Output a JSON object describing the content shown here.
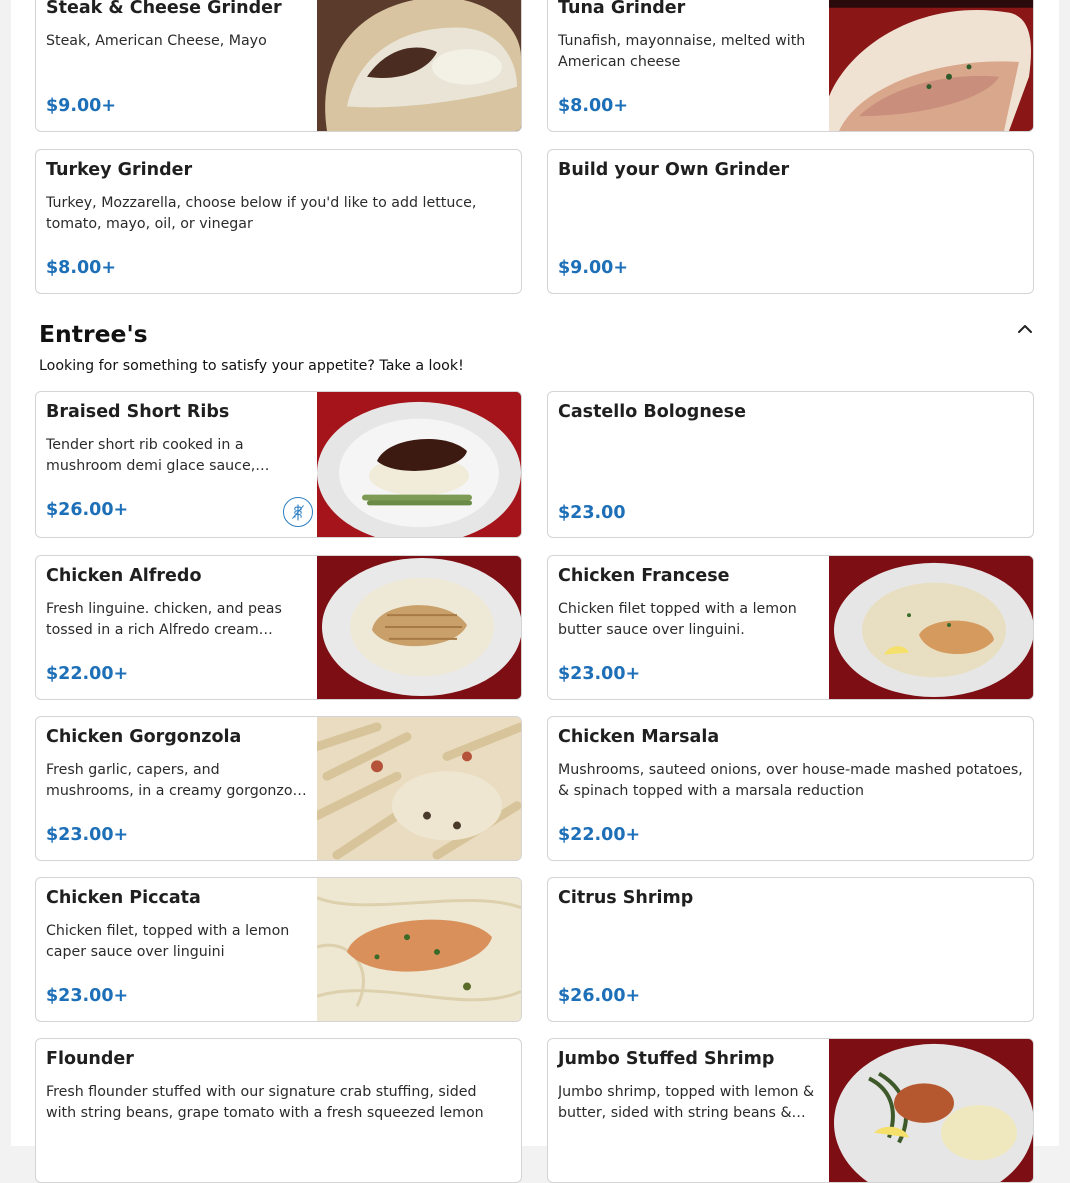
{
  "grinders": [
    {
      "name": "Steak & Cheese Grinder",
      "description": "Steak, American Cheese, Mayo",
      "price": "$9.00+"
    },
    {
      "name": "Tuna Grinder",
      "description": "Tunafish, mayonnaise, melted with American cheese",
      "price": "$8.00+"
    },
    {
      "name": "Turkey Grinder",
      "description": "Turkey, Mozzarella, choose below if you'd like to add lettuce, tomato, mayo, oil, or vinegar",
      "price": "$8.00+"
    },
    {
      "name": "Build your Own Grinder",
      "description": "",
      "price": "$9.00+"
    }
  ],
  "entrees_section": {
    "title": "Entree's",
    "subtitle": "Looking for something to satisfy your appetite? Take a look!",
    "collapse_icon": "chevron-up-icon"
  },
  "entrees": [
    {
      "name": "Braised Short Ribs",
      "description": "Tender short rib cooked in a mushroom demi glace sauce, served over mashed potatoes with asparagus",
      "price": "$26.00+",
      "badge_icon": "wheat-icon"
    },
    {
      "name": "Castello Bolognese",
      "description": "",
      "price": "$23.00"
    },
    {
      "name": "Chicken Alfredo",
      "description": "Fresh linguine. chicken, and peas tossed in a rich Alfredo cream sauce.",
      "price": "$22.00+"
    },
    {
      "name": "Chicken Francese",
      "description": "Chicken filet topped with a lemon butter sauce over linguini.",
      "price": "$23.00+"
    },
    {
      "name": "Chicken Gorgonzola",
      "description": "Fresh garlic, capers, and mushrooms, in a creamy gorgonzola sauce, tossed with penne",
      "price": "$23.00+"
    },
    {
      "name": "Chicken Marsala",
      "description": "Mushrooms, sauteed onions, over house-made mashed potatoes, & spinach topped with a marsala reduction",
      "price": "$22.00+"
    },
    {
      "name": "Chicken Piccata",
      "description": "Chicken filet, topped with a lemon caper sauce over linguini",
      "price": "$23.00+"
    },
    {
      "name": "Citrus Shrimp",
      "description": "",
      "price": "$26.00+"
    },
    {
      "name": "Flounder",
      "description": "Fresh flounder stuffed with our signature crab stuffing, sided with string beans, grape tomato with a fresh squeezed lemon",
      "price": ""
    },
    {
      "name": "Jumbo Stuffed Shrimp",
      "description": "Jumbo shrimp, topped with lemon & butter, sided with string beans & mashed potatoes",
      "price": ""
    }
  ],
  "colors": {
    "price": "#1d6fb8",
    "border": "#d4d4d4",
    "plate_background": "#7a0e12"
  }
}
